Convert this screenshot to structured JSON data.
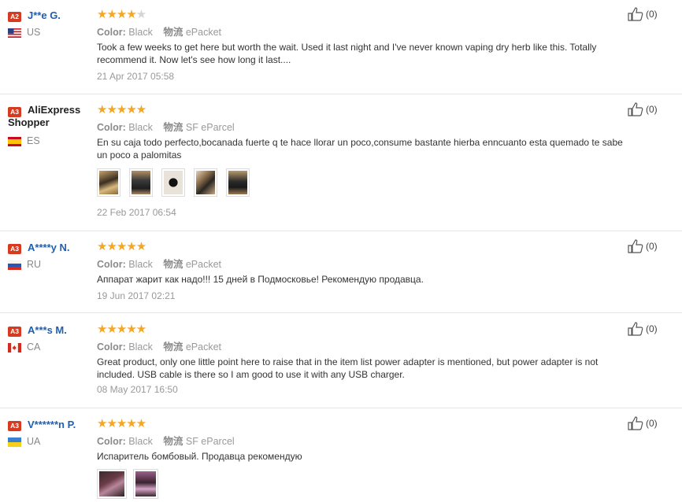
{
  "icons": {
    "helpful": "thumbs-up-icon",
    "star": "star-icon"
  },
  "colors": {
    "star": "#f5a623",
    "name": "#1f5fad",
    "badge": "#d63a1f"
  },
  "reviews": [
    {
      "badge": "A2",
      "name": "J**e G.",
      "country": "US",
      "rating": 4,
      "color_label": "Color:",
      "color_value": "Black",
      "ship_label": "物流",
      "ship_value": "ePacket",
      "text": "Took a few weeks to get here but worth the wait. Used it last night and I've never known vaping dry herb like this. Totally recommend it. Now let's see how long it last....",
      "date": "21 Apr 2017 05:58",
      "helpful": "(0)",
      "photos": 0
    },
    {
      "badge": "A3",
      "name": "AliExpress Shopper",
      "country": "ES",
      "rating": 5,
      "color_label": "Color:",
      "color_value": "Black",
      "ship_label": "物流",
      "ship_value": "SF eParcel",
      "text": "En su caja todo perfecto,bocanada fuerte q te hace llorar un poco,consume bastante hierba enncuanto esta quemado te sabe un poco a palomitas",
      "date": "22 Feb 2017 06:54",
      "helpful": "(0)",
      "photos": 5
    },
    {
      "badge": "A3",
      "name": "A****y N.",
      "country": "RU",
      "rating": 5,
      "color_label": "Color:",
      "color_value": "Black",
      "ship_label": "物流",
      "ship_value": "ePacket",
      "text": "Аппарат жарит как надо!!! 15 дней в Подмосковье! Рекомендую продавца.",
      "date": "19 Jun 2017 02:21",
      "helpful": "(0)",
      "photos": 0
    },
    {
      "badge": "A3",
      "name": "A***s M.",
      "country": "CA",
      "rating": 5,
      "color_label": "Color:",
      "color_value": "Black",
      "ship_label": "物流",
      "ship_value": "ePacket",
      "text": "Great product, only one little point here to raise that in the item list power adapter is mentioned, but power adapter is not included. USB cable is there so I am good to use it with any USB charger.",
      "date": "08 May 2017 16:50",
      "helpful": "(0)",
      "photos": 0
    },
    {
      "badge": "A3",
      "name": "V******n P.",
      "country": "UA",
      "rating": 5,
      "color_label": "Color:",
      "color_value": "Black",
      "ship_label": "物流",
      "ship_value": "SF eParcel",
      "text": "Испаритель бомбовый. Продавца рекомендую",
      "date": "",
      "helpful": "(0)",
      "photos": 2
    }
  ]
}
